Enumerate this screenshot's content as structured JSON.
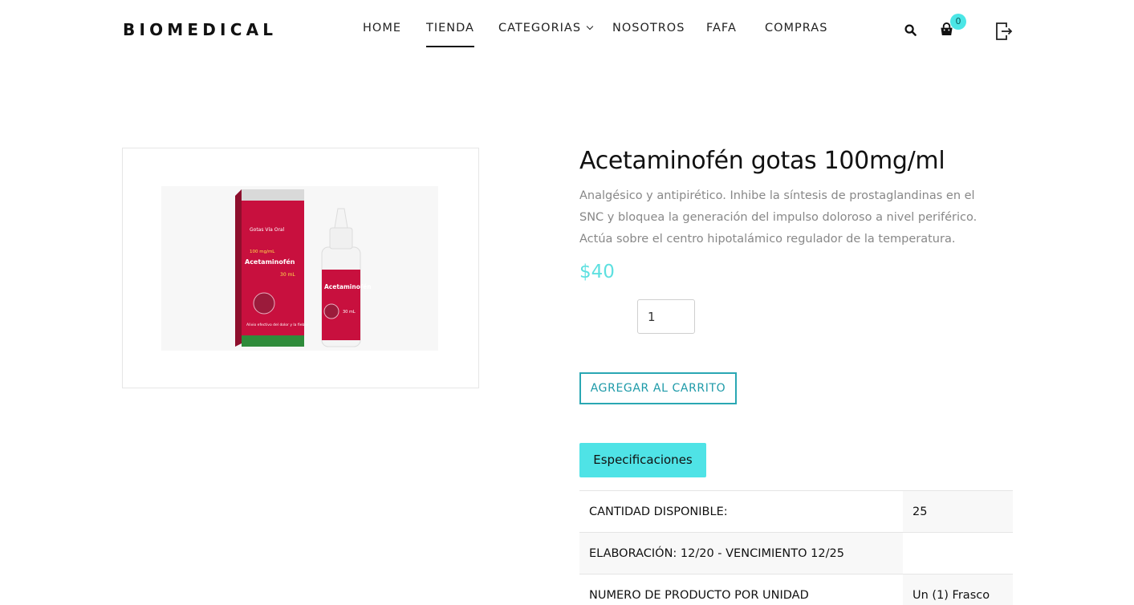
{
  "header": {
    "logo": "BIOMEDICAL",
    "nav": [
      {
        "label": "HOME"
      },
      {
        "label": "TIENDA"
      },
      {
        "label": "CATEGORIAS"
      },
      {
        "label": "NOSOTROS"
      },
      {
        "label": "FAFA"
      },
      {
        "label": "COMPRAS"
      }
    ],
    "active_nav": "TIENDA",
    "cart_count": "0",
    "icons": [
      "search-icon",
      "cart-icon",
      "logout-icon"
    ]
  },
  "product": {
    "image_alt": "Acetaminofén gotas 100mg/ml",
    "image_text": {
      "box_line1": "Gotas Vía Oral",
      "box_line2": "100 mg/mL",
      "box_line3": "Acetaminofén",
      "box_line4": "30 mL",
      "box_line5": "Alivio efectivo del dolor y la fiebre",
      "bottle_line1": "Acetaminofén",
      "bottle_line2": "30 mL"
    },
    "title": "Acetaminofén gotas 100mg/ml",
    "description": "Analgésico y antipirético. Inhibe la síntesis de prostaglandinas en el SNC y bloquea la generación del impulso doloroso a nivel periférico. Actúa sobre el centro hipotalámico regulador de la temperatura.",
    "price": "$40",
    "quantity": "1",
    "add_to_cart": "AGREGAR AL CARRITO",
    "spec_tab": "Especificaciones",
    "specs": [
      {
        "label": "CANTIDAD DISPONIBLE:",
        "value": "25"
      },
      {
        "label": "ELABORACIÓN: 12/20 - VENCIMIENTO 12/25",
        "value": ""
      },
      {
        "label": "NUMERO DE PRODUCTO POR UNIDAD",
        "value": "Un (1) Frasco"
      }
    ]
  },
  "colors": {
    "accent": "#4fe3e6",
    "price": "#5ee0e0",
    "button_border": "#2aa7b3",
    "box_red": "#c8103e"
  }
}
